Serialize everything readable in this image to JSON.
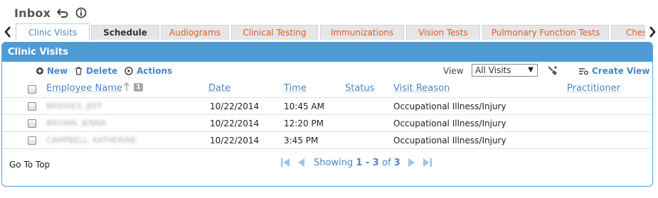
{
  "header": {
    "title": "Inbox"
  },
  "tabs": [
    {
      "label": "Clinic Visits"
    },
    {
      "label": "Schedule"
    },
    {
      "label": "Audiograms"
    },
    {
      "label": "Clinical Testing"
    },
    {
      "label": "Immunizations"
    },
    {
      "label": "Vision Tests"
    },
    {
      "label": "Pulmonary Function Tests"
    },
    {
      "label": "Chest"
    }
  ],
  "panel": {
    "title": "Clinic Visits"
  },
  "toolbar": {
    "new_label": "New",
    "delete_label": "Delete",
    "actions_label": "Actions",
    "view_label": "View",
    "view_selected": "All Visits",
    "create_view_label": "Create View"
  },
  "table": {
    "columns": [
      "Employee Name",
      "Date",
      "Time",
      "Status",
      "Visit Reason",
      "Practitioner"
    ],
    "rows": [
      {
        "name": "BRIDGES, JEFF",
        "date": "10/22/2014",
        "time": "10:45 AM",
        "status": "",
        "reason": "Occupational Illness/Injury",
        "practitioner": ""
      },
      {
        "name": "BROWN, JENNA",
        "date": "10/22/2014",
        "time": "12:20 PM",
        "status": "",
        "reason": "Occupational Illness/Injury",
        "practitioner": ""
      },
      {
        "name": "CAMPBELL, KATHERINE",
        "date": "10/22/2014",
        "time": "3:45 PM",
        "status": "",
        "reason": "Occupational Illness/Injury",
        "practitioner": ""
      }
    ]
  },
  "footer": {
    "goto_top": "Go To Top",
    "showing_prefix": "Showing ",
    "range": "1 - 3",
    "of_text": " of ",
    "total": "3"
  },
  "colors": {
    "accent": "#4d9bd7",
    "tab_text": "#e05a2b",
    "link": "#4a87c5"
  }
}
